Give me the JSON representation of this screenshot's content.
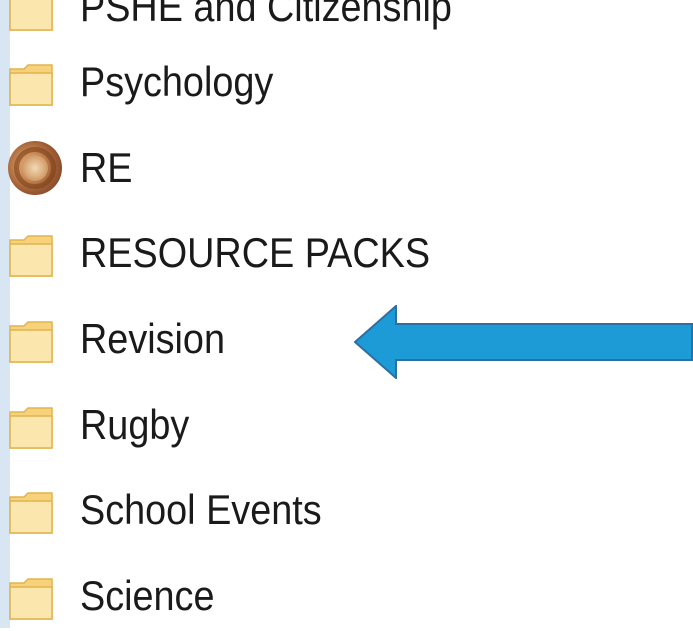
{
  "file_list": {
    "items": [
      {
        "label": "PSHE and Citizenship",
        "icon": "folder-icon"
      },
      {
        "label": "Psychology",
        "icon": "folder-icon"
      },
      {
        "label": "RE",
        "icon": "avatar"
      },
      {
        "label": "RESOURCE PACKS",
        "icon": "folder-icon"
      },
      {
        "label": "Revision",
        "icon": "folder-icon"
      },
      {
        "label": "Rugby",
        "icon": "folder-icon"
      },
      {
        "label": "School Events",
        "icon": "folder-icon"
      },
      {
        "label": "Science",
        "icon": "folder-icon"
      }
    ]
  },
  "annotation": {
    "arrow_color": "#1c9bd6",
    "arrow_outline": "#2d6fa3",
    "points_to": "Revision"
  },
  "colors": {
    "folder_fill": "#f7d27b",
    "folder_light": "#fbe6ad",
    "folder_edge": "#e0b44e",
    "left_strip": "#d8e6f3"
  }
}
